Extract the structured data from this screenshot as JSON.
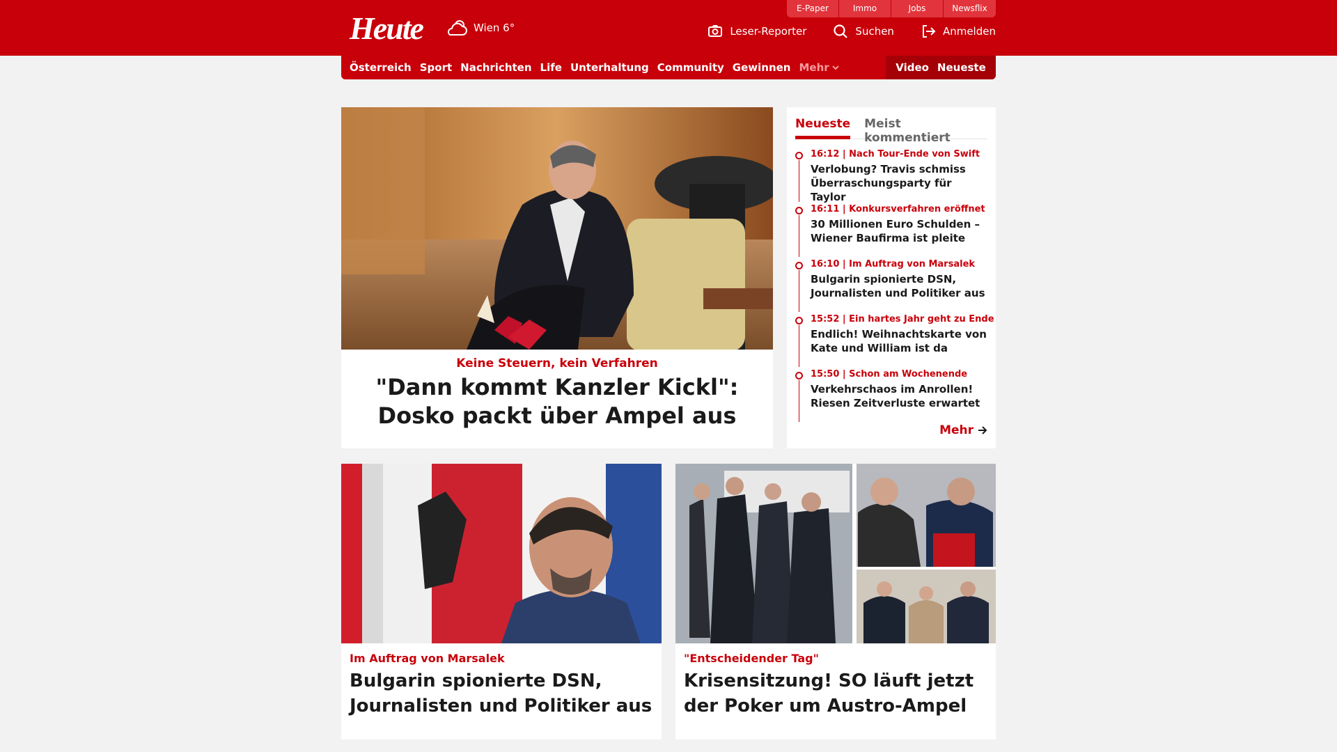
{
  "header": {
    "logo": "Heute",
    "weather": "Wien 6°",
    "top_tabs": [
      "E-Paper",
      "Immo",
      "Jobs",
      "Newsflix"
    ],
    "actions": {
      "reporter": "Leser-Reporter",
      "search": "Suchen",
      "login": "Anmelden"
    }
  },
  "nav": {
    "items": [
      "Österreich",
      "Sport",
      "Nachrichten",
      "Life",
      "Unterhaltung",
      "Community",
      "Gewinnen"
    ],
    "more": "Mehr",
    "video": "Video",
    "latest": "Neueste"
  },
  "hero": {
    "kicker": "Keine Steuern, kein Verfahren",
    "title": "\"Dann kommt Kanzler Kickl\": Dosko packt über Ampel aus"
  },
  "sidebar": {
    "tabs": [
      "Neueste",
      "Meist kommentiert"
    ],
    "items": [
      {
        "meta": "16:12 | Nach Tour-Ende von Swift",
        "title": "Verlobung? Travis schmiss Überraschungsparty für Taylor"
      },
      {
        "meta": "16:11 | Konkursverfahren eröffnet",
        "title": "30 Millionen Euro Schulden – Wiener Baufirma ist pleite"
      },
      {
        "meta": "16:10 | Im Auftrag von Marsalek",
        "title": "Bulgarin spionierte DSN, Journalisten und Politiker aus"
      },
      {
        "meta": "15:52 | Ein hartes Jahr geht zu Ende",
        "title": "Endlich! Weihnachtskarte von Kate und William ist da"
      },
      {
        "meta": "15:50 | Schon am Wochenende",
        "title": "Verkehrschaos im Anrollen! Riesen Zeitverluste erwartet"
      }
    ],
    "more": "Mehr"
  },
  "cards": [
    {
      "kicker": "Im Auftrag von Marsalek",
      "title": "Bulgarin spionierte DSN, Journalisten und Politiker aus"
    },
    {
      "kicker": "\"Entscheidender Tag\"",
      "title": "Krisensitzung! SO läuft jetzt der Poker um Austro-Ampel"
    }
  ],
  "colors": {
    "brand": "#c8000a",
    "brand_dark": "#a50008",
    "tab_bg": "#e2343c"
  }
}
